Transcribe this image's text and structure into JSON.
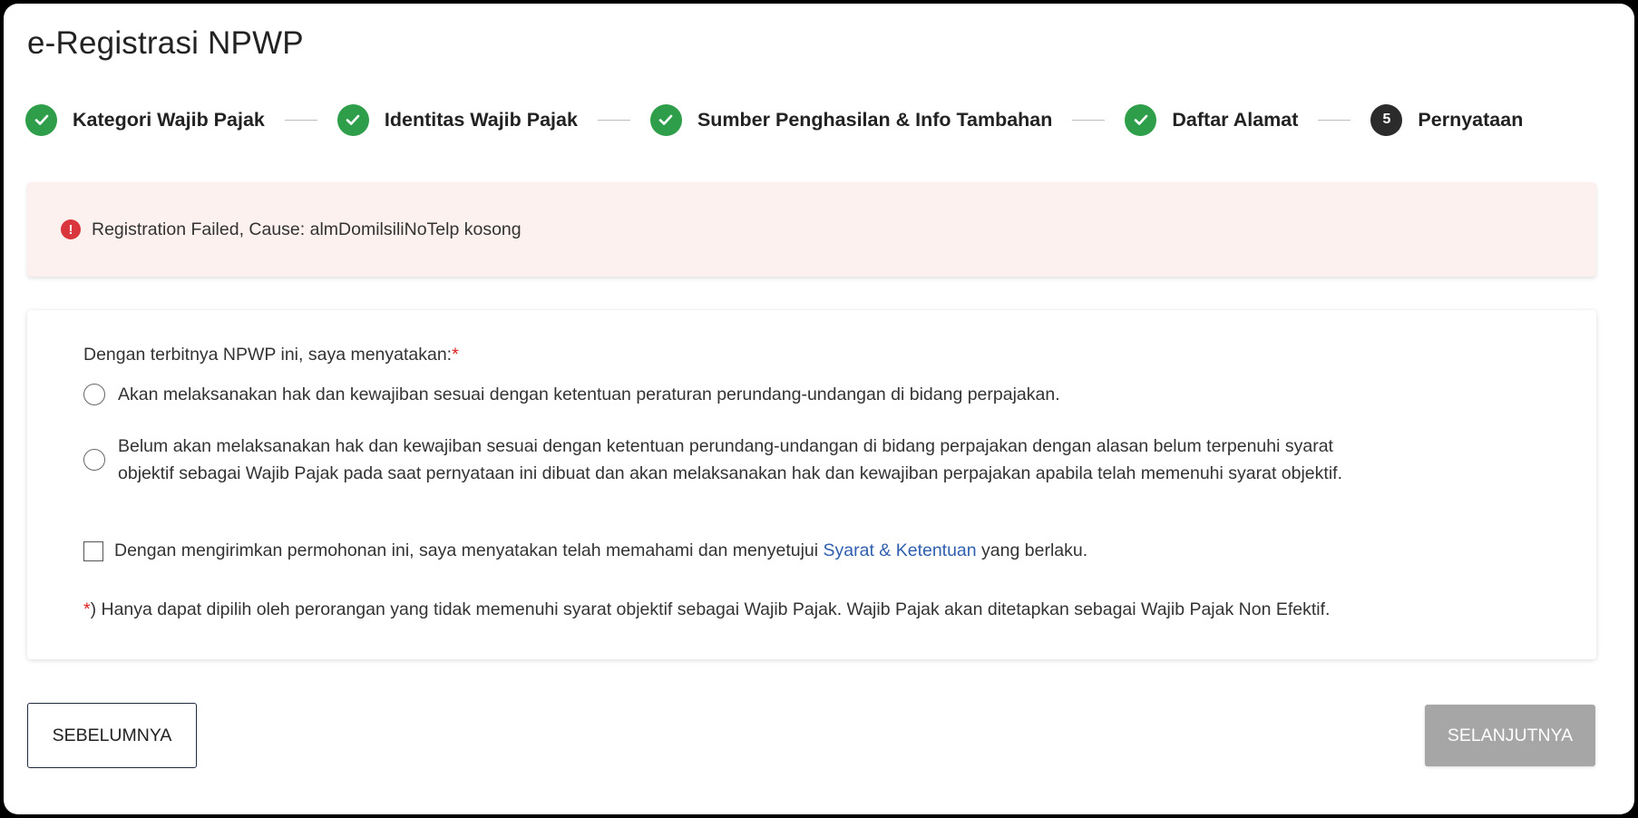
{
  "page": {
    "title": "e-Registrasi NPWP"
  },
  "stepper": {
    "steps": [
      {
        "label": "Kategori Wajib Pajak",
        "status": "done"
      },
      {
        "label": "Identitas Wajib Pajak",
        "status": "done"
      },
      {
        "label": "Sumber Penghasilan & Info Tambahan",
        "status": "done"
      },
      {
        "label": "Daftar Alamat",
        "status": "done"
      },
      {
        "label": "Pernyataan",
        "status": "current",
        "number": "5"
      }
    ]
  },
  "alert": {
    "icon": "!",
    "message": "Registration Failed, Cause: almDomilsiliNoTelp kosong"
  },
  "form": {
    "question": "Dengan terbitnya NPWP ini, saya menyatakan:",
    "required_mark": "*",
    "options": [
      {
        "text": "Akan melaksanakan hak dan kewajiban sesuai dengan ketentuan peraturan perundang-undangan di bidang perpajakan."
      },
      {
        "text_line1": "Belum akan melaksanakan hak dan kewajiban sesuai dengan ketentuan perundang-undangan di bidang perpajakan dengan alasan belum terpenuhi syarat",
        "text_line2": "objektif sebagai Wajib Pajak pada saat pernyataan ini dibuat dan akan melaksanakan hak dan kewajiban perpajakan apabila telah memenuhi syarat objektif."
      }
    ],
    "agreement": {
      "prefix": "Dengan mengirimkan permohonan ini, saya menyatakan telah memahami dan menyetujui ",
      "link": "Syarat & Ketentuan",
      "suffix": " yang berlaku."
    },
    "footnote_mark": "*",
    "footnote": ") Hanya dapat dipilih oleh perorangan yang tidak memenuhi syarat objektif sebagai Wajib Pajak. Wajib Pajak akan ditetapkan sebagai Wajib Pajak Non Efektif."
  },
  "buttons": {
    "prev": "SEBELUMNYA",
    "next": "SELANJUTNYA"
  },
  "colors": {
    "step_done": "#2e9e4a",
    "step_current": "#2b2b2b",
    "alert_bg": "#fdf1ef",
    "alert_icon": "#d9363e",
    "link": "#2f5fae",
    "next_disabled": "#a6a6a6"
  },
  "icons": {
    "step_done": "check-icon",
    "alert": "exclamation-icon"
  }
}
